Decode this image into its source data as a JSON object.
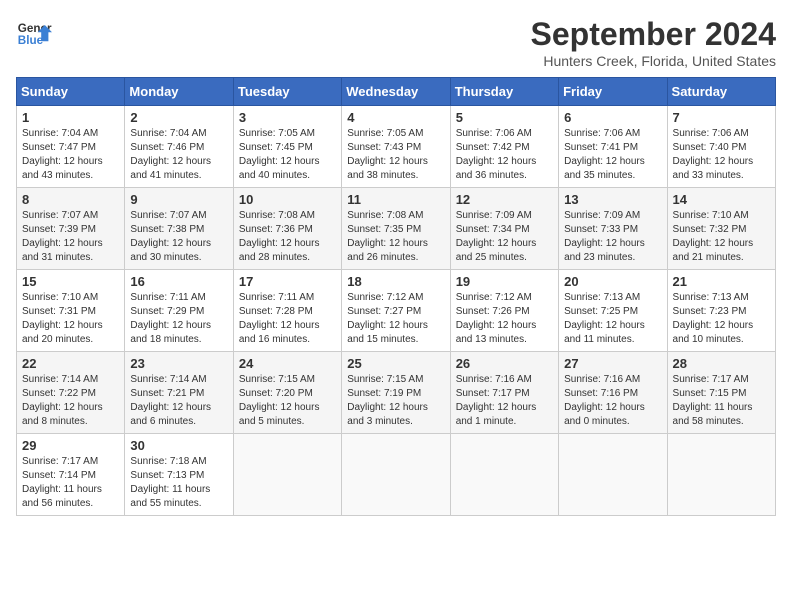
{
  "header": {
    "logo_line1": "General",
    "logo_line2": "Blue",
    "title": "September 2024",
    "subtitle": "Hunters Creek, Florida, United States"
  },
  "columns": [
    "Sunday",
    "Monday",
    "Tuesday",
    "Wednesday",
    "Thursday",
    "Friday",
    "Saturday"
  ],
  "weeks": [
    [
      {
        "day": "1",
        "info": "Sunrise: 7:04 AM\nSunset: 7:47 PM\nDaylight: 12 hours\nand 43 minutes."
      },
      {
        "day": "2",
        "info": "Sunrise: 7:04 AM\nSunset: 7:46 PM\nDaylight: 12 hours\nand 41 minutes."
      },
      {
        "day": "3",
        "info": "Sunrise: 7:05 AM\nSunset: 7:45 PM\nDaylight: 12 hours\nand 40 minutes."
      },
      {
        "day": "4",
        "info": "Sunrise: 7:05 AM\nSunset: 7:43 PM\nDaylight: 12 hours\nand 38 minutes."
      },
      {
        "day": "5",
        "info": "Sunrise: 7:06 AM\nSunset: 7:42 PM\nDaylight: 12 hours\nand 36 minutes."
      },
      {
        "day": "6",
        "info": "Sunrise: 7:06 AM\nSunset: 7:41 PM\nDaylight: 12 hours\nand 35 minutes."
      },
      {
        "day": "7",
        "info": "Sunrise: 7:06 AM\nSunset: 7:40 PM\nDaylight: 12 hours\nand 33 minutes."
      }
    ],
    [
      {
        "day": "8",
        "info": "Sunrise: 7:07 AM\nSunset: 7:39 PM\nDaylight: 12 hours\nand 31 minutes."
      },
      {
        "day": "9",
        "info": "Sunrise: 7:07 AM\nSunset: 7:38 PM\nDaylight: 12 hours\nand 30 minutes."
      },
      {
        "day": "10",
        "info": "Sunrise: 7:08 AM\nSunset: 7:36 PM\nDaylight: 12 hours\nand 28 minutes."
      },
      {
        "day": "11",
        "info": "Sunrise: 7:08 AM\nSunset: 7:35 PM\nDaylight: 12 hours\nand 26 minutes."
      },
      {
        "day": "12",
        "info": "Sunrise: 7:09 AM\nSunset: 7:34 PM\nDaylight: 12 hours\nand 25 minutes."
      },
      {
        "day": "13",
        "info": "Sunrise: 7:09 AM\nSunset: 7:33 PM\nDaylight: 12 hours\nand 23 minutes."
      },
      {
        "day": "14",
        "info": "Sunrise: 7:10 AM\nSunset: 7:32 PM\nDaylight: 12 hours\nand 21 minutes."
      }
    ],
    [
      {
        "day": "15",
        "info": "Sunrise: 7:10 AM\nSunset: 7:31 PM\nDaylight: 12 hours\nand 20 minutes."
      },
      {
        "day": "16",
        "info": "Sunrise: 7:11 AM\nSunset: 7:29 PM\nDaylight: 12 hours\nand 18 minutes."
      },
      {
        "day": "17",
        "info": "Sunrise: 7:11 AM\nSunset: 7:28 PM\nDaylight: 12 hours\nand 16 minutes."
      },
      {
        "day": "18",
        "info": "Sunrise: 7:12 AM\nSunset: 7:27 PM\nDaylight: 12 hours\nand 15 minutes."
      },
      {
        "day": "19",
        "info": "Sunrise: 7:12 AM\nSunset: 7:26 PM\nDaylight: 12 hours\nand 13 minutes."
      },
      {
        "day": "20",
        "info": "Sunrise: 7:13 AM\nSunset: 7:25 PM\nDaylight: 12 hours\nand 11 minutes."
      },
      {
        "day": "21",
        "info": "Sunrise: 7:13 AM\nSunset: 7:23 PM\nDaylight: 12 hours\nand 10 minutes."
      }
    ],
    [
      {
        "day": "22",
        "info": "Sunrise: 7:14 AM\nSunset: 7:22 PM\nDaylight: 12 hours\nand 8 minutes."
      },
      {
        "day": "23",
        "info": "Sunrise: 7:14 AM\nSunset: 7:21 PM\nDaylight: 12 hours\nand 6 minutes."
      },
      {
        "day": "24",
        "info": "Sunrise: 7:15 AM\nSunset: 7:20 PM\nDaylight: 12 hours\nand 5 minutes."
      },
      {
        "day": "25",
        "info": "Sunrise: 7:15 AM\nSunset: 7:19 PM\nDaylight: 12 hours\nand 3 minutes."
      },
      {
        "day": "26",
        "info": "Sunrise: 7:16 AM\nSunset: 7:17 PM\nDaylight: 12 hours\nand 1 minute."
      },
      {
        "day": "27",
        "info": "Sunrise: 7:16 AM\nSunset: 7:16 PM\nDaylight: 12 hours\nand 0 minutes."
      },
      {
        "day": "28",
        "info": "Sunrise: 7:17 AM\nSunset: 7:15 PM\nDaylight: 11 hours\nand 58 minutes."
      }
    ],
    [
      {
        "day": "29",
        "info": "Sunrise: 7:17 AM\nSunset: 7:14 PM\nDaylight: 11 hours\nand 56 minutes."
      },
      {
        "day": "30",
        "info": "Sunrise: 7:18 AM\nSunset: 7:13 PM\nDaylight: 11 hours\nand 55 minutes."
      },
      {
        "day": "",
        "info": ""
      },
      {
        "day": "",
        "info": ""
      },
      {
        "day": "",
        "info": ""
      },
      {
        "day": "",
        "info": ""
      },
      {
        "day": "",
        "info": ""
      }
    ]
  ]
}
